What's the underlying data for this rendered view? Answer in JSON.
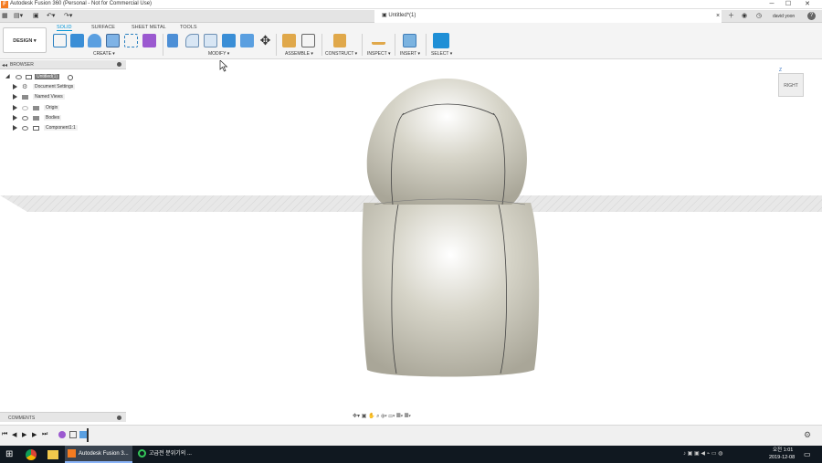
{
  "window": {
    "title": "Autodesk Fusion 360 (Personal - Not for Commercial Use)",
    "logo_letter": "F",
    "minimize": "─",
    "maximize": "☐",
    "close": "✕"
  },
  "document": {
    "tab_title": "Untitled*(1)",
    "tab_close": "×",
    "user": "david yoon",
    "help": "?"
  },
  "ribbon": {
    "workspace": "DESIGN ▾",
    "tabs": [
      "SOLID",
      "SURFACE",
      "SHEET METAL",
      "TOOLS"
    ],
    "groups": [
      "CREATE ▾",
      "MODIFY ▾",
      "ASSEMBLE ▾",
      "CONSTRUCT ▾",
      "INSPECT ▾",
      "INSERT ▾",
      "SELECT ▾"
    ]
  },
  "browser": {
    "title": "BROWSER",
    "root": "Untitled(1)",
    "items": [
      "Document Settings",
      "Named Views",
      "Origin",
      "Bodies",
      "Component1:1"
    ]
  },
  "comments": {
    "title": "COMMENTS"
  },
  "viewcube": {
    "face": "RIGHT",
    "axis_z": "Z"
  },
  "navbar": {
    "icons": "✥▾ ▣ ✋ ⌕ ⊕▾  ▭▾ ▦▾ ▦▾"
  },
  "timeline": {
    "controls": [
      "⏮",
      "◀",
      "▶",
      "▶",
      "⏭"
    ]
  },
  "taskbar": {
    "start": "⊞",
    "apps": [
      "Autodesk Fusion 3...",
      "고급전 분위기의 ..."
    ],
    "time": "오전 1:01",
    "date": "2019-12-08"
  },
  "colors": {
    "accent": "#0696d7",
    "plane": "#d9d9d9",
    "taskbar": "#101820"
  }
}
